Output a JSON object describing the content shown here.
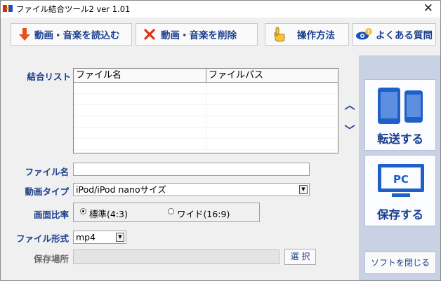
{
  "window": {
    "title": "ファイル結合ツール2 ver 1.01"
  },
  "toolbar": {
    "load_label": "動画・音楽を読込む",
    "delete_label": "動画・音楽を削除",
    "howto_label": "操作方法",
    "faq_label": "よくある質問"
  },
  "list": {
    "label": "結合リスト",
    "columns": [
      "ファイル名",
      "ファイルパス"
    ],
    "rows": []
  },
  "form": {
    "filename_label": "ファイル名",
    "filename_value": "",
    "type_label": "動画タイプ",
    "type_value": "iPod/iPod nanoサイズ",
    "aspect_label": "画面比率",
    "aspect_options": [
      "標準(4:3)",
      "ワイド(16:9)"
    ],
    "aspect_selected": "標準(4:3)",
    "format_label": "ファイル形式",
    "format_value": "mp4",
    "location_label": "保存場所",
    "location_value": "",
    "select_label": "選 択"
  },
  "side": {
    "transfer_label": "転送する",
    "save_label": "保存する",
    "pc_text": "PC",
    "close_label": "ソフトを閉じる"
  },
  "colors": {
    "accent": "#1a3f8f",
    "panel": "#c9d2e4",
    "device_blue": "#1f5fc8",
    "load_arrow": "#e8501a",
    "delete_x": "#d9341c"
  }
}
